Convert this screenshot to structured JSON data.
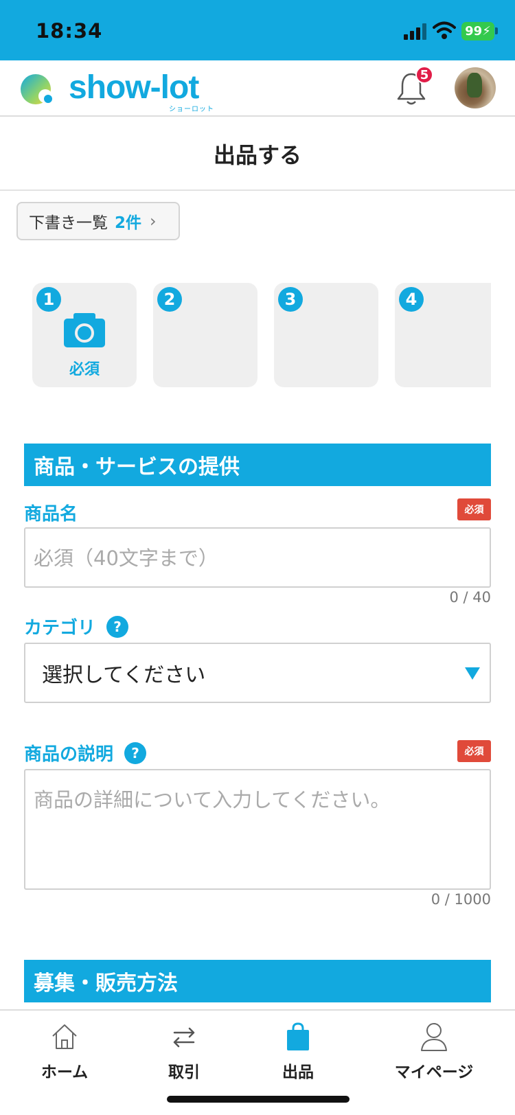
{
  "status": {
    "time": "18:34",
    "battery": "99"
  },
  "header": {
    "logo": "show-lot",
    "logo_sub": "ショーロット",
    "notifications": "5"
  },
  "page": {
    "title": "出品する"
  },
  "drafts": {
    "label": "下書き一覧",
    "count": "2件",
    "chevron": "›"
  },
  "photos": {
    "slots": [
      {
        "number": "1",
        "required_label": "必須"
      },
      {
        "number": "2"
      },
      {
        "number": "3"
      },
      {
        "number": "4"
      }
    ]
  },
  "section1": {
    "title": "商品・サービスの提供",
    "product_name": {
      "label": "商品名",
      "badge": "必須",
      "placeholder": "必須（40文字まで）",
      "counter": "0 / 40"
    },
    "category": {
      "label": "カテゴリ",
      "help": "?",
      "value": "選択してください"
    },
    "description": {
      "label": "商品の説明",
      "help": "?",
      "badge": "必須",
      "placeholder": "商品の詳細について入力してください。",
      "counter": "0 / 1000"
    }
  },
  "section2": {
    "title": "募集・販売方法"
  },
  "nav": {
    "items": [
      {
        "label": "ホーム"
      },
      {
        "label": "取引"
      },
      {
        "label": "出品"
      },
      {
        "label": "マイページ"
      }
    ]
  },
  "colors": {
    "accent": "#12a9df",
    "required": "#e04a3a",
    "badge": "#e11d48"
  }
}
